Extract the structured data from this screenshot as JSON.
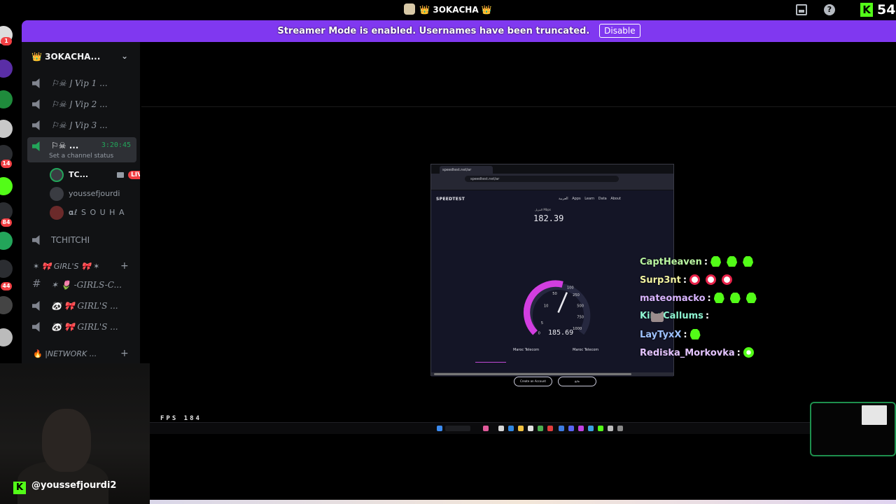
{
  "titlebar": {
    "server_name": "👑 3OKACHA 👑",
    "viewer_count": "54"
  },
  "banner": {
    "message": "Streamer Mode is enabled. Usernames have been truncated.",
    "disable_label": "Disable"
  },
  "rail": {
    "badges": [
      "1",
      "14",
      "84",
      "44"
    ]
  },
  "sidebar": {
    "server_header": "👑 3OKACHA...",
    "channels": [
      {
        "label": "⚐☠︎ ⌋ Vip 1 ..."
      },
      {
        "label": "⚐☠︎ ⌋ Vip 2 ..."
      },
      {
        "label": "⚐☠︎ ⌋ Vip 3 ..."
      }
    ],
    "active_channel": {
      "label": "⚐☠︎ ...",
      "time": "3:20:45",
      "status": "Set a channel status"
    },
    "voice_users": [
      {
        "name": "TC...",
        "live": "LIVE"
      },
      {
        "name": "youssefjourdi"
      },
      {
        "name": "𝛂ℓ S O U H A"
      }
    ],
    "tchitchi": "TCHITCHI",
    "category_girls": "✶ 🎀 GIRL'S 🎀 ✶",
    "girls_channels": [
      {
        "label": "✶ 🌷 -GIRLS-C..."
      },
      {
        "label": "🐼 🎀 GIRL'S ..."
      },
      {
        "label": "🐼 🎀 GIRL'S ..."
      }
    ],
    "category_network": "|NETWORK ..."
  },
  "stream": {
    "fps": "FPS 184",
    "browser": {
      "tab_title": "speedtest.net/ar",
      "url": "speedtest.net/ar",
      "logo": "SPEEDTEST",
      "nav": "العربية   Apps   Learn   Data   About",
      "download_label": "التنزيل Mbps",
      "download_value": "182.39",
      "gauge_value": "185.69",
      "gauge_ticks": [
        "0",
        "5",
        "10",
        "50",
        "100",
        "250",
        "500",
        "750",
        "1000"
      ],
      "isp_left": "Maroc Telecom",
      "isp_right": "Maroc Telecom",
      "button_left": "Create an Account",
      "button_right": "نتائج"
    }
  },
  "chat": [
    {
      "user": "CaptHeaven",
      "color": "#b9f5a0",
      "emotes": [
        "kick",
        "kick",
        "kick"
      ]
    },
    {
      "user": "Surp3nt",
      "color": "#f2f2a0",
      "emotes": [
        "red",
        "red",
        "red"
      ]
    },
    {
      "user": "mateomacko",
      "color": "#d8b4fe",
      "emotes": [
        "kick",
        "kick",
        "kick"
      ]
    },
    {
      "user": "KingCallums",
      "color": "#8ef5d2",
      "emotes": [
        "cat",
        "cat",
        "cat"
      ]
    },
    {
      "user": "LayTyxX",
      "color": "#9fc3ff",
      "emotes": [
        "kick"
      ]
    },
    {
      "user": "Rediska_Morkovka",
      "color": "#e4c4ff",
      "emotes": [
        "peace"
      ]
    }
  ],
  "streamer": {
    "handle": "@youssefjourdi2"
  },
  "colors": {
    "accent_purple": "#8038f0",
    "kick_green": "#53fc18",
    "live_red": "#f23f43",
    "voice_green": "#23a55a"
  }
}
